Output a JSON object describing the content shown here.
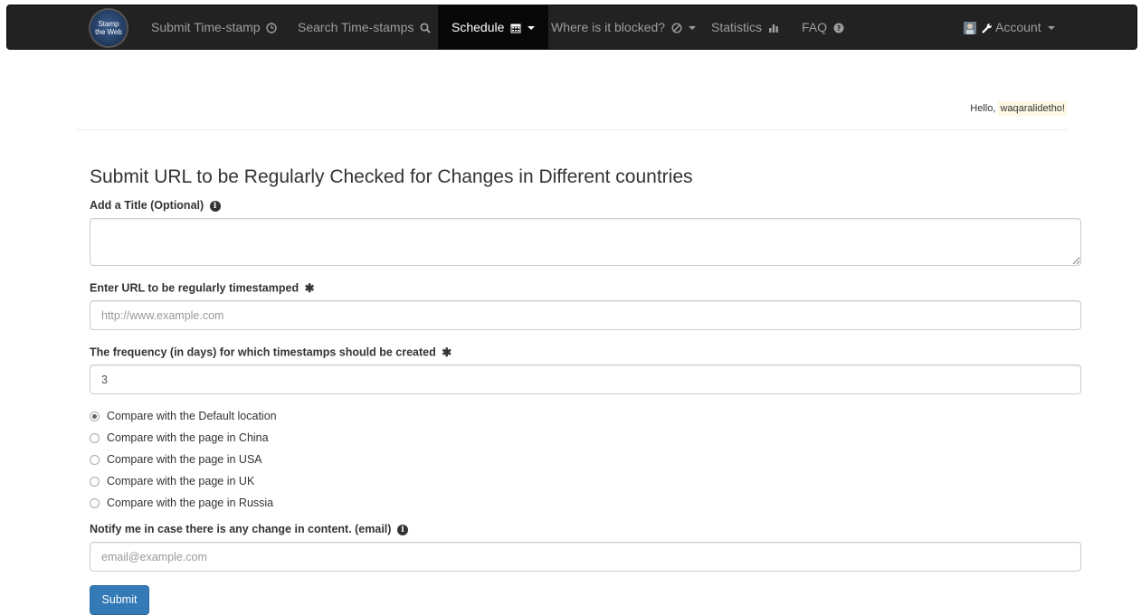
{
  "navbar": {
    "brand": {
      "line1": "Stamp",
      "line2": "the Web"
    },
    "items": [
      {
        "label": "Submit Time-stamp",
        "icon": "clock-icon"
      },
      {
        "label": "Search Time-stamps",
        "icon": "search-icon"
      },
      {
        "label": "Schedule",
        "icon": "calendar-icon",
        "active": true
      },
      {
        "label": "Where is it blocked?",
        "icon": "ban-icon"
      },
      {
        "label": "Statistics",
        "icon": "bar-chart-icon"
      },
      {
        "label": "FAQ",
        "icon": "question-circle-icon"
      }
    ],
    "account": {
      "label": "Account",
      "icon": "wrench-icon"
    }
  },
  "greeting": {
    "prefix": "Hello,",
    "username": "waqaralidetho!"
  },
  "form": {
    "heading": "Submit URL to be Regularly Checked for Changes in Different countries",
    "title_label": "Add a Title (Optional)",
    "title_value": "",
    "url_label": "Enter URL to be regularly timestamped",
    "url_placeholder": "http://www.example.com",
    "frequency_label": "The frequency (in days) for which timestamps should be created",
    "frequency_value": "3",
    "locations": [
      {
        "label": "Compare with the Default location",
        "checked": true
      },
      {
        "label": "Compare with the page in China",
        "checked": false
      },
      {
        "label": "Compare with the page in USA",
        "checked": false
      },
      {
        "label": "Compare with the page in UK",
        "checked": false
      },
      {
        "label": "Compare with the page in Russia",
        "checked": false
      }
    ],
    "email_label": "Notify me in case there is any change in content. (email)",
    "email_placeholder": "email@example.com",
    "submit_label": "Submit"
  },
  "colors": {
    "navbar_bg": "#222222",
    "primary": "#337ab7",
    "highlight": "#fcf8e3"
  }
}
